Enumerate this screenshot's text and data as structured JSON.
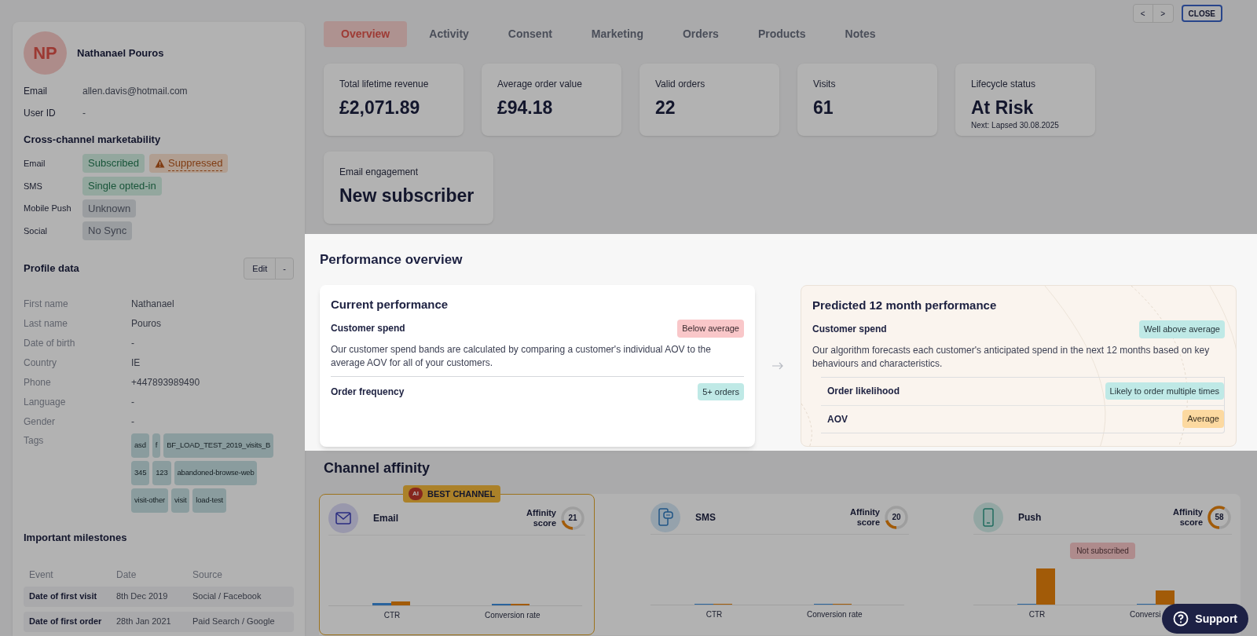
{
  "nav": {
    "prev": "<",
    "next": ">",
    "close": "CLOSE"
  },
  "profile": {
    "initials": "NP",
    "name": "Nathanael Pouros",
    "fields": [
      {
        "label": "Email",
        "value": "allen.davis@hotmail.com"
      },
      {
        "label": "User ID",
        "value": "-"
      }
    ]
  },
  "marketability": {
    "title": "Cross-channel marketability",
    "rows": [
      {
        "channel": "Email",
        "badges": [
          {
            "text": "Subscribed",
            "kind": "success"
          },
          {
            "text": "Suppressed",
            "kind": "warning"
          }
        ]
      },
      {
        "channel": "SMS",
        "badges": [
          {
            "text": "Single opted-in",
            "kind": "success"
          }
        ]
      },
      {
        "channel": "Mobile Push",
        "badges": [
          {
            "text": "Unknown",
            "kind": "neutral"
          }
        ]
      },
      {
        "channel": "Social",
        "badges": [
          {
            "text": "No Sync",
            "kind": "neutral"
          }
        ]
      }
    ]
  },
  "profile_data": {
    "title": "Profile data",
    "edit": "Edit",
    "more": "-",
    "fields": [
      {
        "label": "First name",
        "value": "Nathanael"
      },
      {
        "label": "Last name",
        "value": "Pouros"
      },
      {
        "label": "Date of birth",
        "value": "-"
      },
      {
        "label": "Country",
        "value": "IE"
      },
      {
        "label": "Phone",
        "value": "+447893989490"
      },
      {
        "label": "Language",
        "value": "-"
      },
      {
        "label": "Gender",
        "value": "-"
      }
    ],
    "tags_label": "Tags",
    "tags": [
      "asd",
      "f",
      "BF_LOAD_TEST_2019_visits_B",
      "345",
      "123",
      "abandoned-browse-web",
      "visit-other",
      "visit",
      "load-test"
    ]
  },
  "milestones": {
    "title": "Important milestones",
    "columns": [
      "Event",
      "Date",
      "Source"
    ],
    "rows": [
      [
        "Date of first visit",
        "8th Dec 2019",
        "Social / Facebook"
      ],
      [
        "Date of first order",
        "28th Jan 2021",
        "Paid Search / Google"
      ]
    ]
  },
  "tabs": [
    {
      "label": "Overview",
      "selected": true
    },
    {
      "label": "Activity",
      "selected": false
    },
    {
      "label": "Consent",
      "selected": false
    },
    {
      "label": "Marketing",
      "selected": false
    },
    {
      "label": "Orders",
      "selected": false
    },
    {
      "label": "Products",
      "selected": false
    },
    {
      "label": "Notes",
      "selected": false
    }
  ],
  "stats": [
    {
      "label": "Total lifetime revenue",
      "value": "£2,071.89"
    },
    {
      "label": "Average order value",
      "value": "£94.18"
    },
    {
      "label": "Valid orders",
      "value": "22"
    },
    {
      "label": "Visits",
      "value": "61"
    },
    {
      "label": "Lifecycle status",
      "value": "At Risk",
      "note": "Next: Lapsed 30.08.2025"
    }
  ],
  "engagement": {
    "label": "Email engagement",
    "value": "New subscriber"
  },
  "performance": {
    "title": "Performance overview",
    "current": {
      "title": "Current performance",
      "rows": [
        {
          "label": "Customer spend",
          "badge": {
            "text": "Below average",
            "kind": "danger"
          },
          "description": "Our customer spend bands are calculated by comparing a customer's individual AOV to the average AOV for all of your customers."
        },
        {
          "label": "Order frequency",
          "badge": {
            "text": "5+ orders",
            "kind": "info"
          }
        }
      ]
    },
    "predicted": {
      "title": "Predicted 12 month performance",
      "rows": [
        {
          "label": "Customer spend",
          "badge": {
            "text": "Well above average",
            "kind": "info"
          },
          "description": "Our algorithm forecasts each customer's anticipated spend in the next 12 months based on key behaviours and characteristics."
        }
      ],
      "sub_rows": [
        {
          "label": "Order likelihood",
          "badge": {
            "text": "Likely to order multiple times",
            "kind": "info"
          }
        },
        {
          "label": "AOV",
          "badge": {
            "text": "Average",
            "kind": "amber"
          }
        }
      ]
    }
  },
  "channel_affinity": {
    "title": "Channel affinity",
    "best_badge": "BEST CHANNEL",
    "ai_mark": "AI",
    "channels": [
      {
        "name": "Email",
        "kind": "email",
        "best": true,
        "affinity_label": "Affinity score",
        "score": "21",
        "level": 0.21,
        "metrics": [
          "CTR",
          "Conversion rate"
        ]
      },
      {
        "name": "SMS",
        "kind": "sms",
        "best": false,
        "affinity_label": "Affinity score",
        "score": "20",
        "level": 0.2,
        "metrics": [
          "CTR",
          "Conversion rate"
        ]
      },
      {
        "name": "Push",
        "kind": "push",
        "best": false,
        "affinity_label": "Affinity score",
        "score": "58",
        "level": 0.58,
        "metrics": [
          "CTR",
          "Conversi"
        ],
        "note": "Not subscribed"
      }
    ]
  },
  "support": "Support"
}
